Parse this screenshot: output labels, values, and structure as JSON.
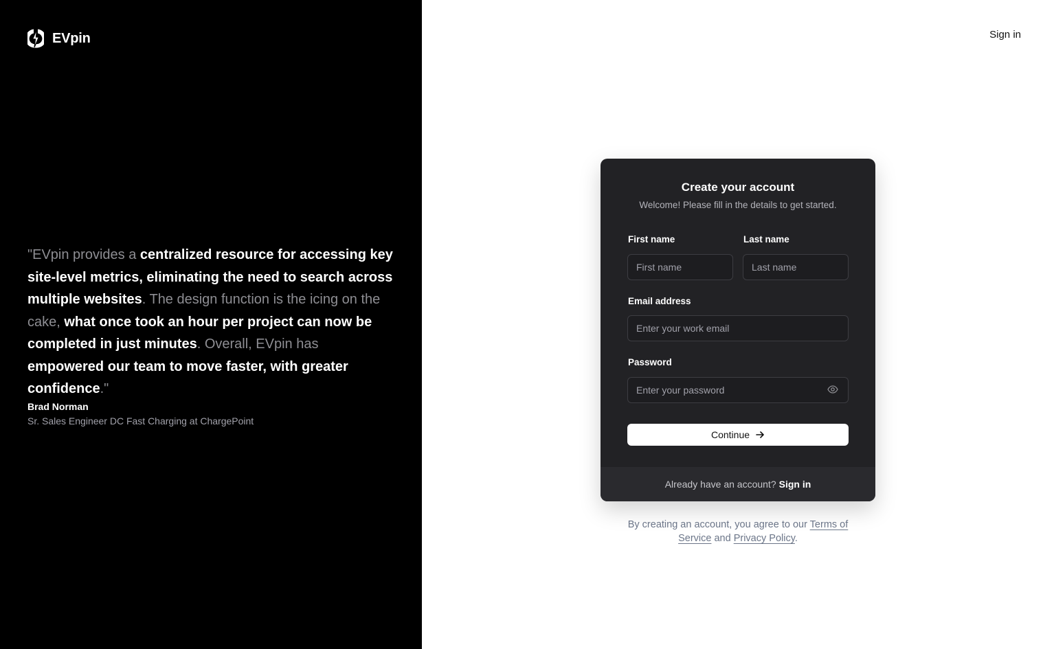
{
  "brand": {
    "name": "EVpin",
    "logo_icon": "lightning-bolt-icon"
  },
  "testimonial": {
    "open_quote": "\"",
    "parts": [
      "EVpin provides a ",
      "centralized resource for accessing key site-level metrics, eliminating the need to search across multiple websites",
      ". The design function is the icing on the cake, ",
      "what once took an hour per project can now be completed in just minutes",
      ". Overall, EVpin has ",
      "empowered our team to move faster, with greater confidence",
      "."
    ],
    "close_quote": "\"",
    "author_name": "Brad Norman",
    "author_role": "Sr. Sales Engineer DC Fast Charging at ChargePoint"
  },
  "header": {
    "signin_label": "Sign in"
  },
  "form": {
    "title": "Create your account",
    "subtitle": "Welcome! Please fill in the details to get started.",
    "first_name": {
      "label": "First name",
      "placeholder": "First name"
    },
    "last_name": {
      "label": "Last name",
      "placeholder": "Last name"
    },
    "email": {
      "label": "Email address",
      "placeholder": "Enter your work email"
    },
    "password": {
      "label": "Password",
      "placeholder": "Enter your password",
      "toggle_icon": "eye-icon"
    },
    "continue_label": "Continue",
    "continue_icon": "arrow-right-icon",
    "footer_prompt": "Already have an account?",
    "footer_link": "Sign in"
  },
  "legal": {
    "prefix": "By creating an account, you agree to our ",
    "terms": "Terms of Service",
    "middle": " and ",
    "privacy": "Privacy Policy",
    "suffix": "."
  },
  "colors": {
    "left_panel_bg": "#000000",
    "card_bg": "#222225",
    "muted_text": "#8e8e93"
  }
}
